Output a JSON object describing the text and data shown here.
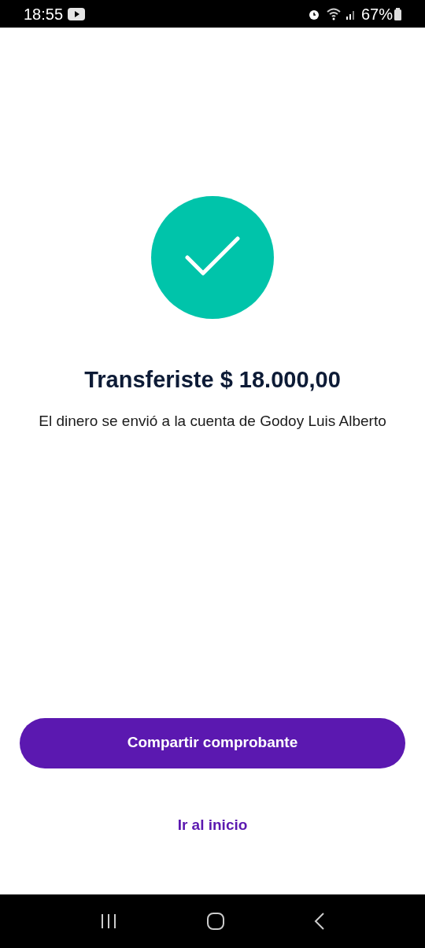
{
  "status_bar": {
    "time": "18:55",
    "battery": "67%"
  },
  "title": "Transferiste $ 18.000,00",
  "message": "El dinero se envió a la cuenta de Godoy Luis Alberto",
  "primary_button": "Compartir comprobante",
  "link": "Ir al inicio"
}
